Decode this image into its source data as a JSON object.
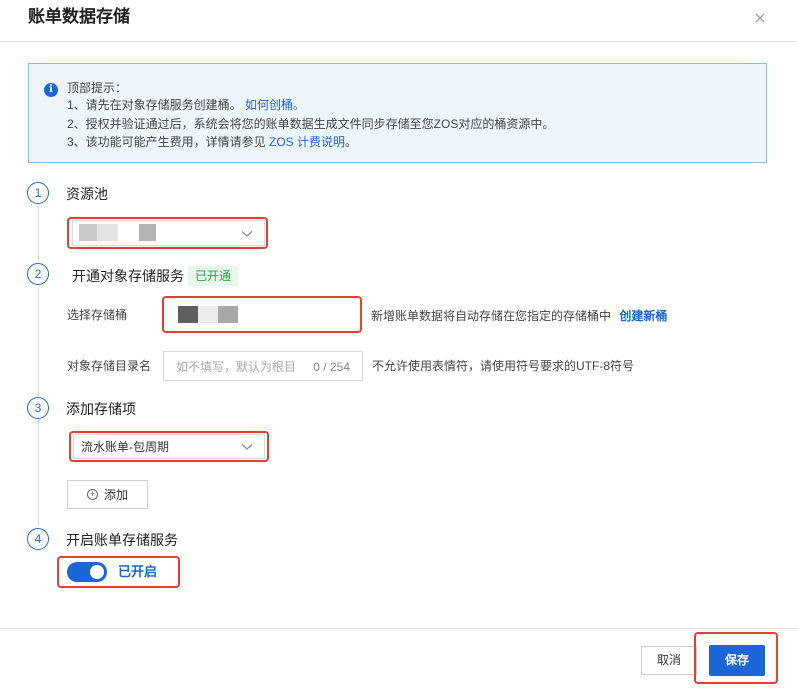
{
  "dialog": {
    "title": "账单数据存储",
    "close_icon": "close-icon"
  },
  "notice": {
    "icon": "info-icon",
    "heading": "顶部提示：",
    "line1_prefix": "1、请先在对象存储服务创建桶。",
    "line1_link": "如何创桶。",
    "line2": "2、授权并验证通过后，系统会将您的账单数据生成文件同步存储至您ZOS对应的桶资源中。",
    "line3_prefix": "3、该功能可能产生费用，详情请参见 ",
    "line3_link": "ZOS 计费说明",
    "line3_suffix": "。"
  },
  "steps": [
    {
      "number": "1",
      "title": "资源池"
    },
    {
      "number": "2",
      "title": "开通对象存储服务",
      "badge": "已开通"
    },
    {
      "number": "3",
      "title": "添加存储项"
    },
    {
      "number": "4",
      "title": "开启账单存储服务"
    }
  ],
  "bucket": {
    "label": "选择存储桶",
    "hint": "新增账单数据将自动存储在您指定的存储桶中",
    "create_link": "创建新桶"
  },
  "directory": {
    "label": "对象存储目录名",
    "placeholder": "如不填写，默认为根目",
    "counter": "0 / 254",
    "hint": "不允许使用表情符，请使用符号要求的UTF-8符号"
  },
  "storage_item": {
    "selected": "流水账单-包周期"
  },
  "add_button": {
    "icon": "plus-circle-icon",
    "label": "添加"
  },
  "service_toggle": {
    "on": true,
    "label": "已开启"
  },
  "footer": {
    "cancel_label": "取消",
    "save_label": "保存"
  },
  "colors": {
    "accent": "#1a66d9",
    "highlight": "#e2412f",
    "success": "#2aa34a"
  }
}
